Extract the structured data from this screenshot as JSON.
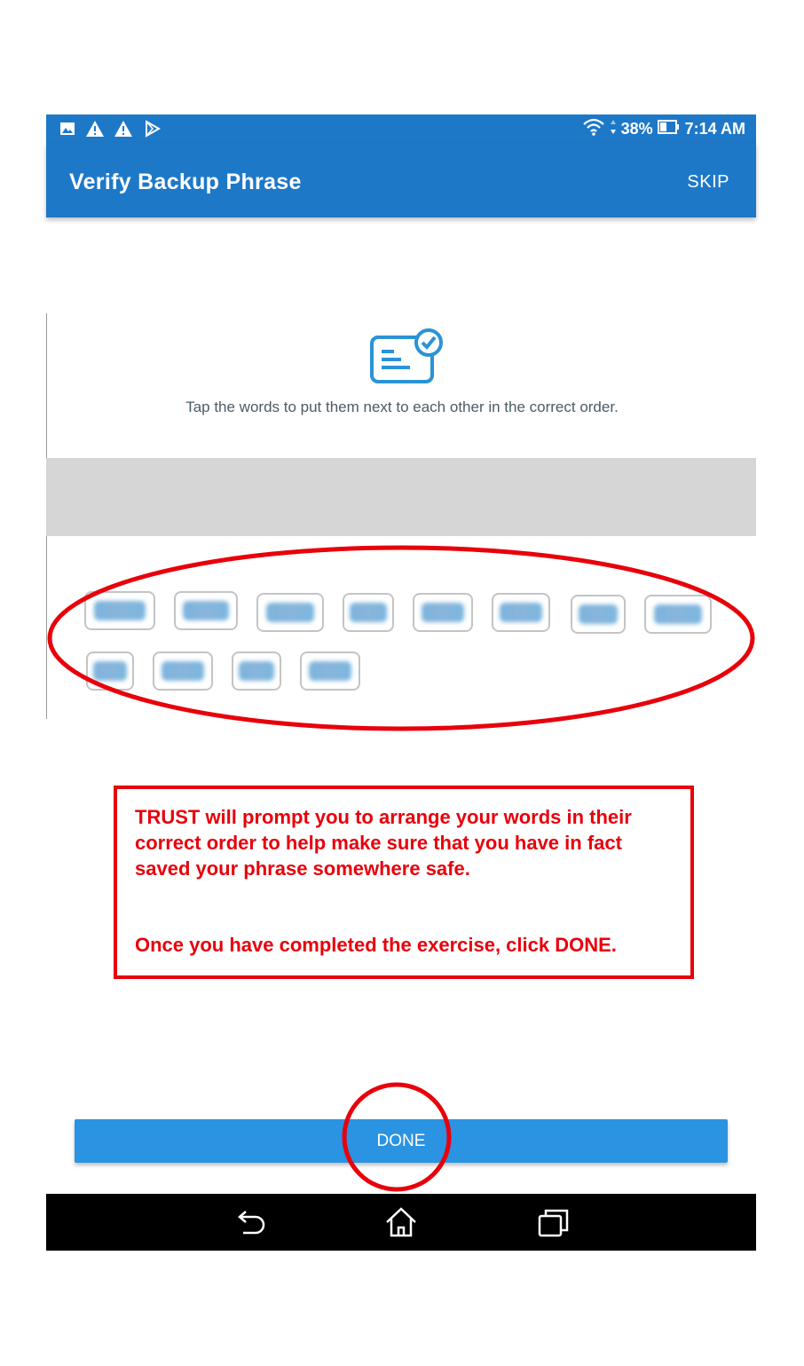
{
  "status_bar": {
    "battery": "38%",
    "time": "7:14 AM",
    "left_icons": [
      "image-icon",
      "warning-icon",
      "warning-icon",
      "play-store-icon"
    ],
    "right_icons": [
      "wifi-icon",
      "data-arrows-icon",
      "battery-icon"
    ]
  },
  "app_bar": {
    "title": "Verify Backup Phrase",
    "skip_label": "SKIP"
  },
  "instruction": {
    "icon": "document-check-icon",
    "text": "Tap the words to put them next to each other in the correct order."
  },
  "word_chips": {
    "count": 12,
    "content": "blurred"
  },
  "annotation": {
    "color": "#e8000b",
    "paragraph1": "TRUST will prompt you to arrange your words in their correct order to help make sure that you have in fact saved your phrase somewhere safe.",
    "paragraph2": "Once you have completed the exercise, click DONE."
  },
  "done_button": {
    "label": "DONE"
  },
  "nav_bar": {
    "icons": [
      "back-icon",
      "home-icon",
      "recents-icon"
    ]
  },
  "colors": {
    "primary": "#1e78c8",
    "button": "#2a93e2",
    "annotation": "#e8000b"
  }
}
